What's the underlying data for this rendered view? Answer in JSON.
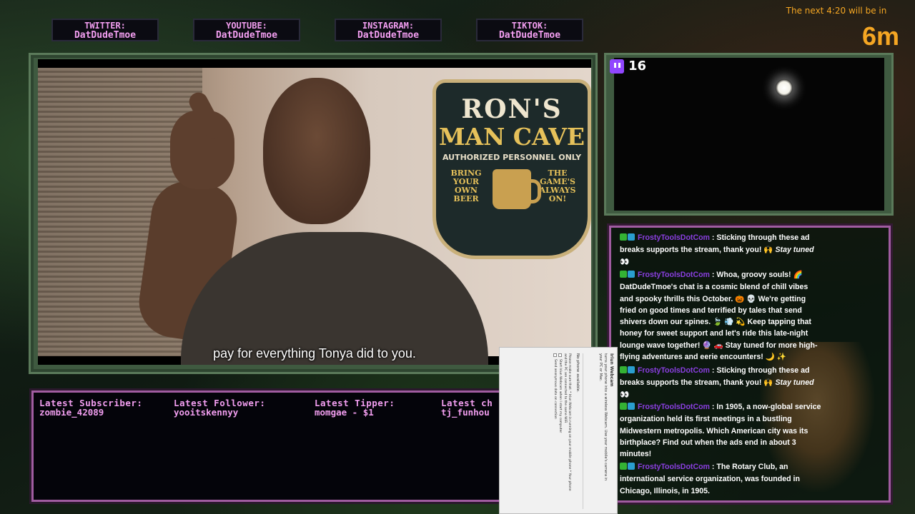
{
  "socials": [
    {
      "platform": "TWITTER:",
      "handle": "DatDudeTmoe"
    },
    {
      "platform": "YOUTUBE:",
      "handle": "DatDudeTmoe"
    },
    {
      "platform": "INSTAGRAM:",
      "handle": "DatDudeTmoe"
    },
    {
      "platform": "TIKTOK:",
      "handle": "DatDudeTmoe"
    }
  ],
  "countdown": {
    "text": "The next 4:20 will be in",
    "value": "6m"
  },
  "video": {
    "sign_line1": "RON'S",
    "sign_line2": "MAN CAVE",
    "sign_line3": "AUTHORIZED PERSONNEL ONLY",
    "sign_left": "BRING YOUR OWN BEER",
    "sign_right": "THE GAME'S ALWAYS ON!",
    "subtitle": "pay for everything Tonya did to you."
  },
  "camera": {
    "viewer_count": "16",
    "icon": "twitch-icon"
  },
  "chat": {
    "messages": [
      {
        "user": "FrostyToolsDotCom",
        "text": "Sticking through these ad breaks supports the stream, thank you! 🙌 ",
        "italic": "Stay tuned",
        "tail": " 👀"
      },
      {
        "user": "FrostyToolsDotCom",
        "text": "Whoa, groovy souls! 🌈 DatDudeTmoe's chat is a cosmic blend of chill vibes and spooky thrills this October. 🎃 💀 We're getting fried on good times and terrified by tales that send shivers down our spines. 🍃 💨 💫 Keep tapping that honey for sweet support and let's ride this late-night lounge wave together! 🔮 🚗 Stay tuned for more high-flying adventures and eerie encounters! 🌙 ✨",
        "italic": "",
        "tail": ""
      },
      {
        "user": "FrostyToolsDotCom",
        "text": "Sticking through these ad breaks supports the stream, thank you! 🙌 ",
        "italic": "Stay tuned",
        "tail": " 👀"
      },
      {
        "user": "FrostyToolsDotCom",
        "text": "In 1905, a now-global service organization held its first meetings in a bustling Midwestern metropolis. Which American city was its birthplace? Find out when the ads end in about 3 minutes!",
        "italic": "",
        "tail": ""
      },
      {
        "user": "FrostyToolsDotCom",
        "text": "The Rotary Club, an international service organization, was founded in Chicago, Illinois, in 1905.",
        "italic": "",
        "tail": ""
      }
    ]
  },
  "ticker": {
    "latest_subscriber": {
      "label": "Latest Subscriber:",
      "value": "zombie_42089"
    },
    "latest_follower": {
      "label": "Latest Follower:",
      "value": "yooitskennyy"
    },
    "latest_tipper": {
      "label": "Latest Tipper:",
      "value": "momgae - $1"
    },
    "latest_cheer": {
      "label": "Latest ch",
      "value": "tj_funhou"
    }
  },
  "popup": {
    "title": "Iriun Webcam",
    "description": "turns your phone into a wireless Webcam. Use your mobile's camera in your PC or Mac.",
    "header": "No phone available.",
    "instructions": "Please make sure that: * Iriun Webcam is running on your mobile phone * Your phone and the PC are connected to the same WiFi",
    "check1": "Start Iriun Webcam when I start my computer",
    "check2": "Send anonymous data on connection"
  }
}
